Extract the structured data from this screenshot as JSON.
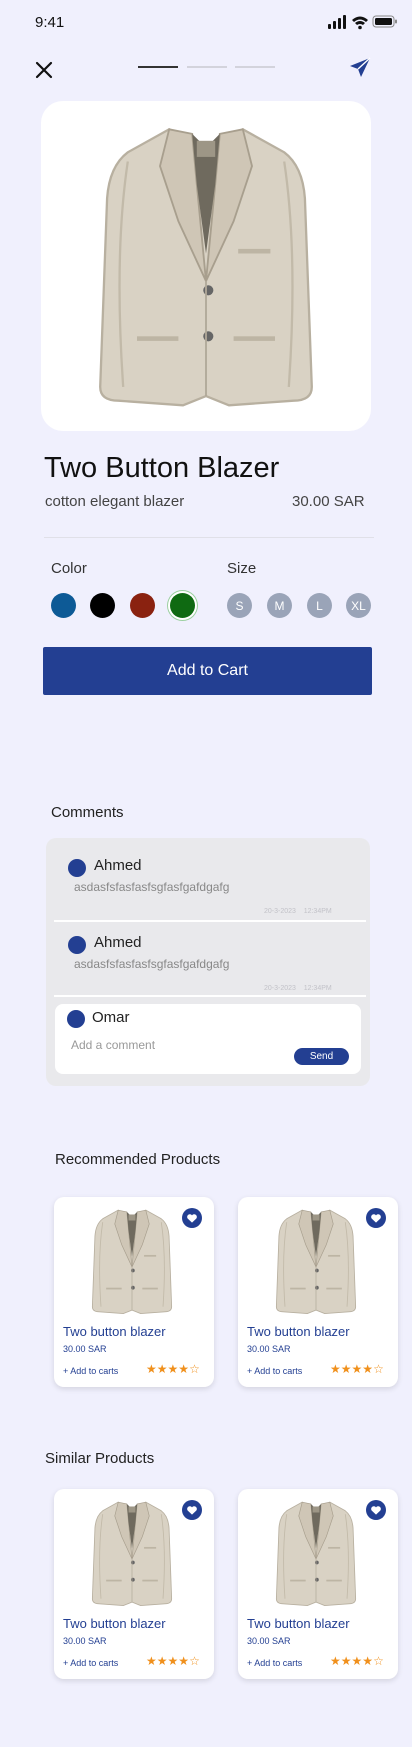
{
  "status_bar": {
    "time": "9:41"
  },
  "product": {
    "title": "Two Button Blazer",
    "subtitle": "cotton elegant blazer",
    "price": "30.00 SAR",
    "color_label": "Color",
    "size_label": "Size",
    "colors": [
      "#0d5a96",
      "#000000",
      "#8a2210",
      "#0f6a12"
    ],
    "selected_color_index": 3,
    "sizes": [
      "S",
      "M",
      "L",
      "XL"
    ],
    "add_to_cart": "Add to Cart",
    "stepper_active_index": 0
  },
  "comments": {
    "title": "Comments",
    "items": [
      {
        "name": "Ahmed",
        "text": "asdasfsfasfasfsgfasfgafdgafg",
        "time": "20-3-2023    12:34PM"
      },
      {
        "name": "Ahmed",
        "text": "asdasfsfasfasfsgfasfgafdgafg",
        "time": "20-3-2023    12:34PM"
      }
    ],
    "composer": {
      "name": "Omar",
      "placeholder": "Add a comment",
      "send": "Send"
    }
  },
  "recommended": {
    "title": "Recommended Products",
    "cards": [
      {
        "name": "Two button blazer",
        "price": "30.00 SAR",
        "add": "+ Add to carts",
        "rating": 4
      },
      {
        "name": "Two button blazer",
        "price": "30.00 SAR",
        "add": "+ Add to carts",
        "rating": 4
      }
    ]
  },
  "similar": {
    "title": "Similar Products",
    "cards": [
      {
        "name": "Two button blazer",
        "price": "30.00 SAR",
        "add": "+ Add to carts",
        "rating": 4
      },
      {
        "name": "Two button blazer",
        "price": "30.00 SAR",
        "add": "+ Add to carts",
        "rating": 4
      }
    ]
  },
  "colors": {
    "accent": "#233f92",
    "background": "#f0f0fd",
    "star": "#f0901c"
  }
}
